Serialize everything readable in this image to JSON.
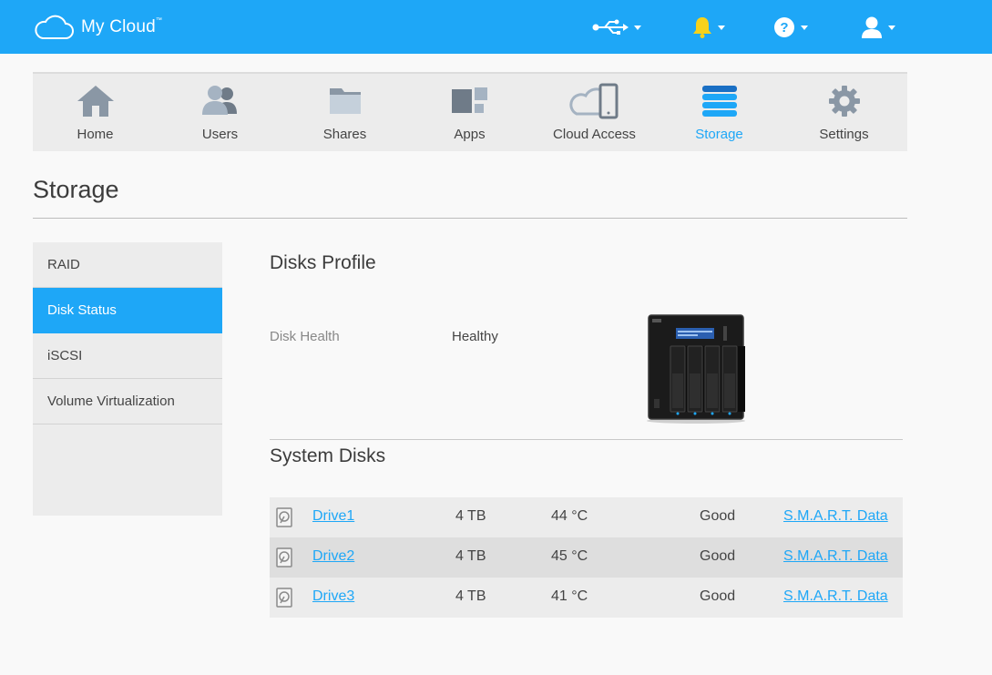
{
  "header": {
    "brand": "My Cloud",
    "brand_tm": "™",
    "icons": [
      "usb-icon",
      "bell-icon",
      "help-icon",
      "user-icon"
    ],
    "bell_color": "#f6d21b"
  },
  "nav": {
    "items": [
      {
        "label": "Home",
        "icon": "home-icon"
      },
      {
        "label": "Users",
        "icon": "users-icon"
      },
      {
        "label": "Shares",
        "icon": "shares-folder-icon"
      },
      {
        "label": "Apps",
        "icon": "apps-icon"
      },
      {
        "label": "Cloud Access",
        "icon": "cloud-access-icon"
      },
      {
        "label": "Storage",
        "icon": "storage-icon"
      },
      {
        "label": "Settings",
        "icon": "settings-gear-icon"
      }
    ],
    "active": "Storage"
  },
  "page": {
    "title": "Storage"
  },
  "sidebar": {
    "items": [
      {
        "label": "RAID"
      },
      {
        "label": "Disk Status"
      },
      {
        "label": "iSCSI"
      },
      {
        "label": "Volume Virtualization"
      }
    ],
    "active": "Disk Status"
  },
  "profile": {
    "title": "Disks Profile",
    "health_label": "Disk Health",
    "health_value": "Healthy"
  },
  "system_disks": {
    "title": "System Disks",
    "rows": [
      {
        "name": "Drive1",
        "size": "4 TB",
        "temp": "44 °C",
        "status": "Good",
        "link": "S.M.A.R.T. Data"
      },
      {
        "name": "Drive2",
        "size": "4 TB",
        "temp": "45 °C",
        "status": "Good",
        "link": "S.M.A.R.T. Data"
      },
      {
        "name": "Drive3",
        "size": "4 TB",
        "temp": "41 °C",
        "status": "Good",
        "link": "S.M.A.R.T. Data"
      }
    ]
  },
  "colors": {
    "accent": "#1ea7f7",
    "nav_bg": "#ececec"
  }
}
